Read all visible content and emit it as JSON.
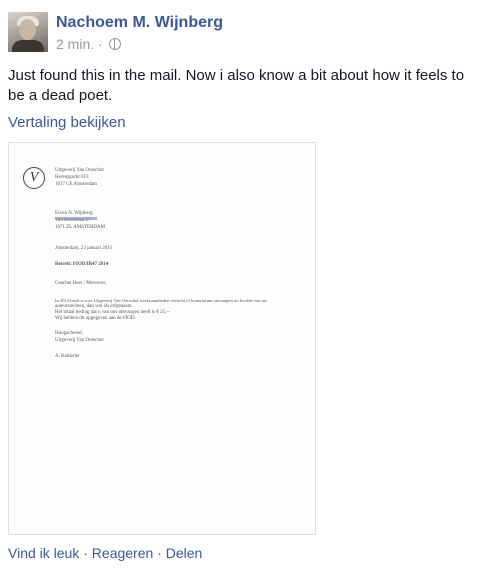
{
  "post": {
    "author": "Nachoem M. Wijnberg",
    "timestamp": "2 min.",
    "separator": "·",
    "privacy_icon": "globe-icon",
    "text": "Just found this in the mail. Now i also know a bit about how it feels to be a dead poet.",
    "translate_label": "Vertaling bekijken"
  },
  "letter": {
    "logo_glyph": "V",
    "sender_line1": "Uitgeverij Van Oorschot",
    "sender_line2": "Herengracht 613",
    "sender_line3": "1017 CE Amsterdam",
    "recipient_name": "Erven N. Wijnberg",
    "recipient_street": "Van Breestraat 27",
    "recipient_city": "1071 ZL AMSTERDAM",
    "date": "Amsterdam, 23 januari 2015",
    "subject": "Betreft: FIOD/IB47 2014",
    "salutation": "Geachte Heer / Mevrouw,",
    "body1": "In 2014 heeft u voor Uitgeverij Van Oorschot werkzaamheden verricht of honorarium ontvangen uit hoofde van uw",
    "body2": "auteursrechten, dan wel als erfgenaam.",
    "body3": "Het totaal bedrag dat u van ons ontvangen heeft is € 25,--",
    "body4": "Wij hebben dit opgegeven aan de FIOD.",
    "closing1": "Hoogachtend,",
    "closing2": "Uitgeverij Van Oorschot",
    "signature": "A. Kokkeler"
  },
  "actions": {
    "like": "Vind ik leuk",
    "comment": "Reageren",
    "share": "Delen",
    "sep": "·"
  }
}
